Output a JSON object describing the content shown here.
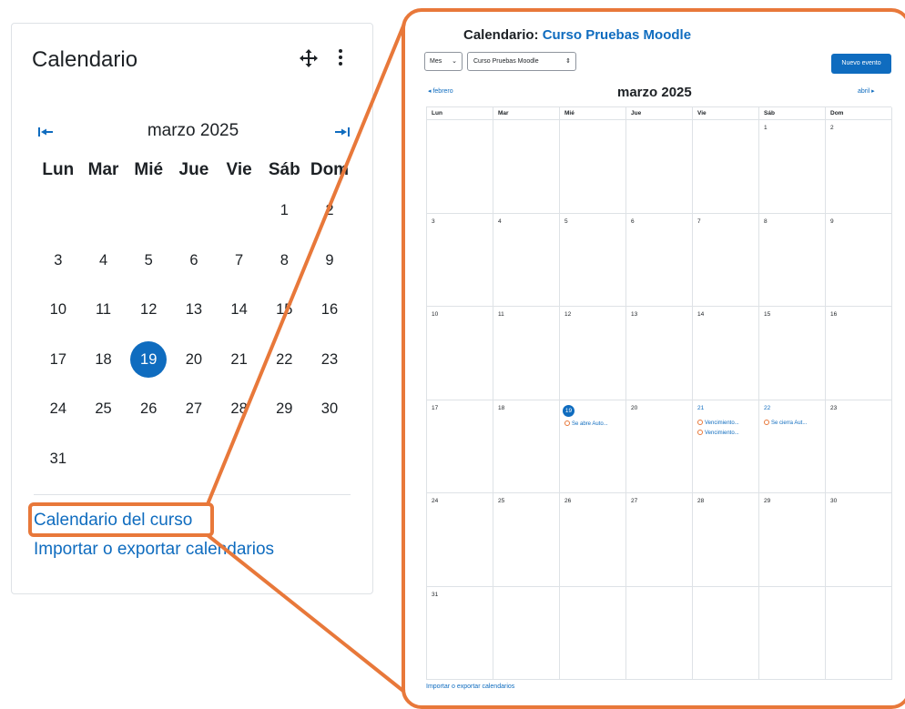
{
  "block": {
    "title": "Calendario",
    "month_title": "marzo 2025",
    "weekdays": [
      "Lun",
      "Mar",
      "Mié",
      "Jue",
      "Vie",
      "Sáb",
      "Dom"
    ],
    "weeks": [
      [
        "",
        "",
        "",
        "",
        "",
        "1",
        "2"
      ],
      [
        "3",
        "4",
        "5",
        "6",
        "7",
        "8",
        "9"
      ],
      [
        "10",
        "11",
        "12",
        "13",
        "14",
        "15",
        "16"
      ],
      [
        "17",
        "18",
        "19",
        "20",
        "21",
        "22",
        "23"
      ],
      [
        "24",
        "25",
        "26",
        "27",
        "28",
        "29",
        "30"
      ],
      [
        "31",
        "",
        "",
        "",
        "",
        "",
        ""
      ]
    ],
    "today": "19",
    "link_course": "Calendario del curso",
    "link_import": "Importar o exportar calendarios"
  },
  "big": {
    "title_prefix": "Calendario:",
    "title_course": "Curso Pruebas Moodle",
    "view_select": "Mes",
    "course_select": "Curso Pruebas Moodle",
    "new_event_button": "Nuevo evento",
    "prev_month": "febrero",
    "next_month": "abril",
    "month_title": "marzo 2025",
    "weekdays": [
      "Lun",
      "Mar",
      "Mié",
      "Jue",
      "Vie",
      "Sáb",
      "Dom"
    ],
    "weeks": [
      [
        "",
        "",
        "",
        "",
        "",
        "1",
        "2"
      ],
      [
        "3",
        "4",
        "5",
        "6",
        "7",
        "8",
        "9"
      ],
      [
        "10",
        "11",
        "12",
        "13",
        "14",
        "15",
        "16"
      ],
      [
        "17",
        "18",
        "19",
        "20",
        "21",
        "22",
        "23"
      ],
      [
        "24",
        "25",
        "26",
        "27",
        "28",
        "29",
        "30"
      ],
      [
        "31",
        "",
        "",
        "",
        "",
        "",
        ""
      ]
    ],
    "today": "19",
    "events": {
      "19": [
        "Se abre Auto..."
      ],
      "21": [
        "Vencimiento...",
        "Vencimiento..."
      ],
      "22": [
        "Se cierra Aut..."
      ]
    },
    "import_link": "Importar o exportar calendarios"
  },
  "colors": {
    "accent": "#0f6cbf",
    "callout": "#e8783a",
    "border": "#dee2e6"
  }
}
